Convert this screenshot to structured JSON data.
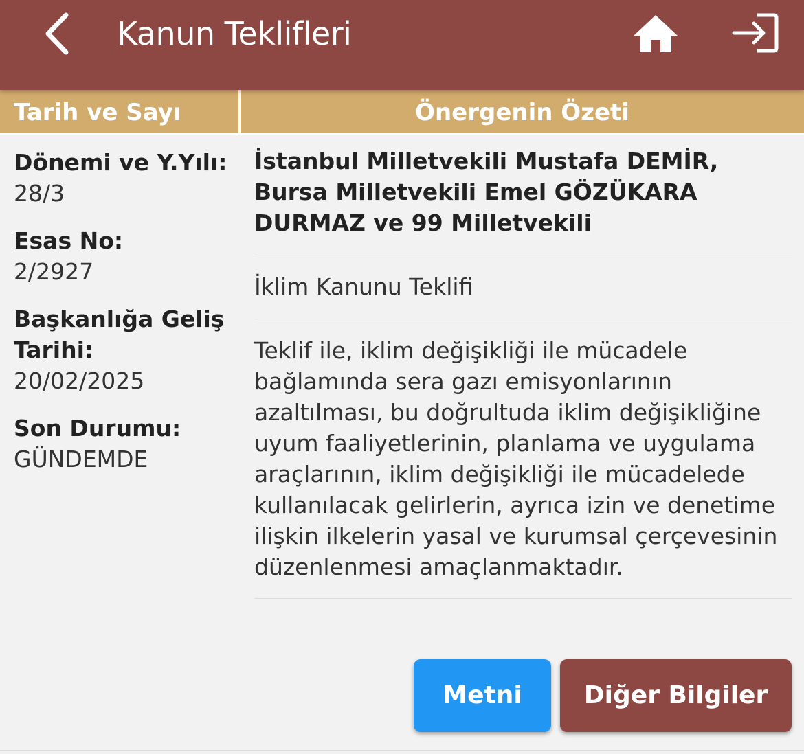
{
  "header": {
    "title": "Kanun Teklifleri",
    "background_color": "#8e4843",
    "icons": [
      "back-chevron-icon",
      "home-icon",
      "logout-icon"
    ]
  },
  "table_header": {
    "left": "Tarih ve Sayı",
    "right": "Önergenin Özeti",
    "background_color": "#d2ac6c"
  },
  "details": {
    "term_label": "Dönemi ve Y.Yılı:",
    "term_value": "28/3",
    "esas_label": "Esas No:",
    "esas_value": "2/2927",
    "arrival_label": "Başkanlığa Geliş Tarihi:",
    "arrival_value": "20/02/2025",
    "status_label": "Son Durumu:",
    "status_value": "GÜNDEMDE"
  },
  "summary": {
    "proposers": "İstanbul  Milletvekili Mustafa DEMİR, Bursa  Milletvekili Emel GÖZÜKARA DURMAZ ve 99 Milletvekili",
    "title": "İklim Kanunu Teklifi",
    "text": "Teklif ile, iklim değişikliği ile mücadele bağlamında sera gazı emisyonlarının azaltılması, bu doğrultuda iklim değişikliğine uyum faaliyetlerinin, planlama ve uygulama araçlarının, iklim değişikliği ile mücadelede kullanılacak gelirlerin, ayrıca izin ve denetime ilişkin ilkelerin yasal ve kurumsal çerçevesinin düzenlenmesi amaçlanmaktadır."
  },
  "buttons": {
    "text_label": "Metni",
    "text_color": "#2196f3",
    "other_label": "Diğer Bilgiler",
    "other_color": "#8e4843"
  }
}
